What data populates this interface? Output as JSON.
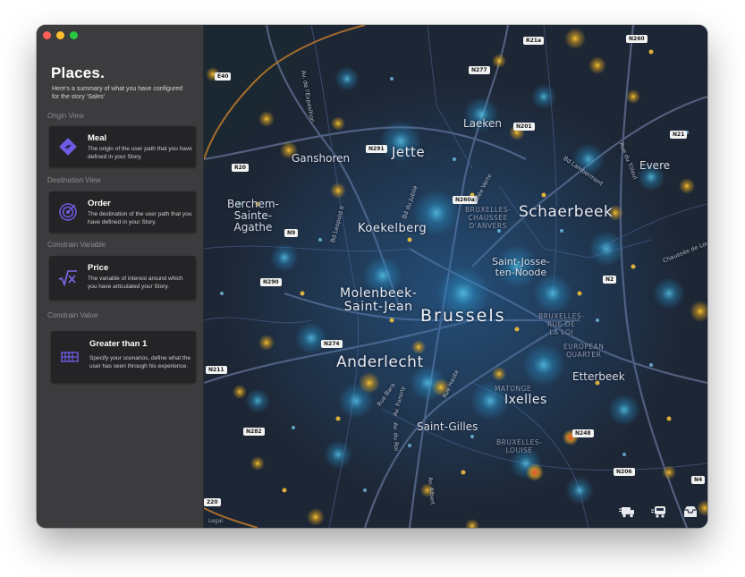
{
  "sidebar": {
    "title": "Places.",
    "subtitle": "Here's a summary of what you have configured for the story 'Sales'",
    "sections": [
      {
        "label": "Origin View",
        "card_title": "Meal",
        "card_desc": "The origin of the user path that you have defined in your Story.",
        "icon": "route-diamond-icon",
        "icon_color": "#6e5ce6"
      },
      {
        "label": "Destination View",
        "card_title": "Order",
        "card_desc": "The destination of the user path that you have defined in your Story.",
        "icon": "target-icon",
        "icon_color": "#6e5ce6"
      },
      {
        "label": "Constrain Variable",
        "card_title": "Price",
        "card_desc": "The variable of interest around which you have articulated your Story.",
        "icon": "square-root-x-icon",
        "icon_color": "#6e5ce6"
      },
      {
        "label": "Constrain Value",
        "card_title": "Greater than 1",
        "card_desc": "Specify your scenarios, define what the user has seen through his experience.",
        "icon": "filter-range-icon",
        "icon_color": "#6e5ce6"
      }
    ]
  },
  "map": {
    "city": "Brussels",
    "districts": {
      "jette": "Jette",
      "ganshoren": "Ganshoren",
      "laeken": "Laeken",
      "schaerbeek": "Schaerbeek",
      "evere": "Evere",
      "berchem": "Berchem-\nSainte-\nAgathe",
      "koekelberg": "Koekelberg",
      "molenbeek": "Molenbeek-\nSaint-Jean",
      "saint_josse": "Saint-Josse-\nten-Noode",
      "anderlecht": "Anderlecht",
      "etterbeek": "Etterbeek",
      "ixelles": "Ixelles",
      "saint_gilles": "Saint-Gilles"
    },
    "areas": {
      "bruxelles_chaussee": "BRUXELLES-\nCHAUSSÉE\nD'ANVERS",
      "bruxelles_loi": "BRUXELLES-\nRUE DE\nLA LOI",
      "european_quarter": "EUROPEAN\nQUARTER",
      "matonge": "MATONGE",
      "bruxelles_louise": "BRUXELLES-\nLOUISE"
    },
    "roads": {
      "n21a": "R21a",
      "n260": "N260",
      "n277": "N277",
      "e40": "E40",
      "n201": "N201",
      "n21": "N21",
      "n291": "N291",
      "r20": "R20",
      "n260a": "N260a",
      "n9": "N9",
      "n290": "N290",
      "n2": "N2",
      "n274": "N274",
      "r21": "N211",
      "n282": "N282",
      "n248": "N248",
      "n206": "N206",
      "n4": "N4",
      "r220": "220"
    },
    "streets": {
      "expo": "Av. de l'Exposition",
      "laeken_blvd": "Bd du Jubilé",
      "allee_verte": "Allée Verte",
      "lambermont": "Bd Lambermont",
      "tilleul": "Rue du Tilleul",
      "louvain": "Chaussée de Louvain",
      "bara": "Rue Bara",
      "fonsny": "Av. Fonsny",
      "midi": "Rue Haute",
      "roi": "Av. du Roi",
      "brabant": "Bd Leopold II",
      "albert": "Av. Albert"
    },
    "legal": "Legal",
    "buttons": [
      "delivery-truck-icon",
      "transit-icon",
      "inbox-tray-icon"
    ]
  }
}
